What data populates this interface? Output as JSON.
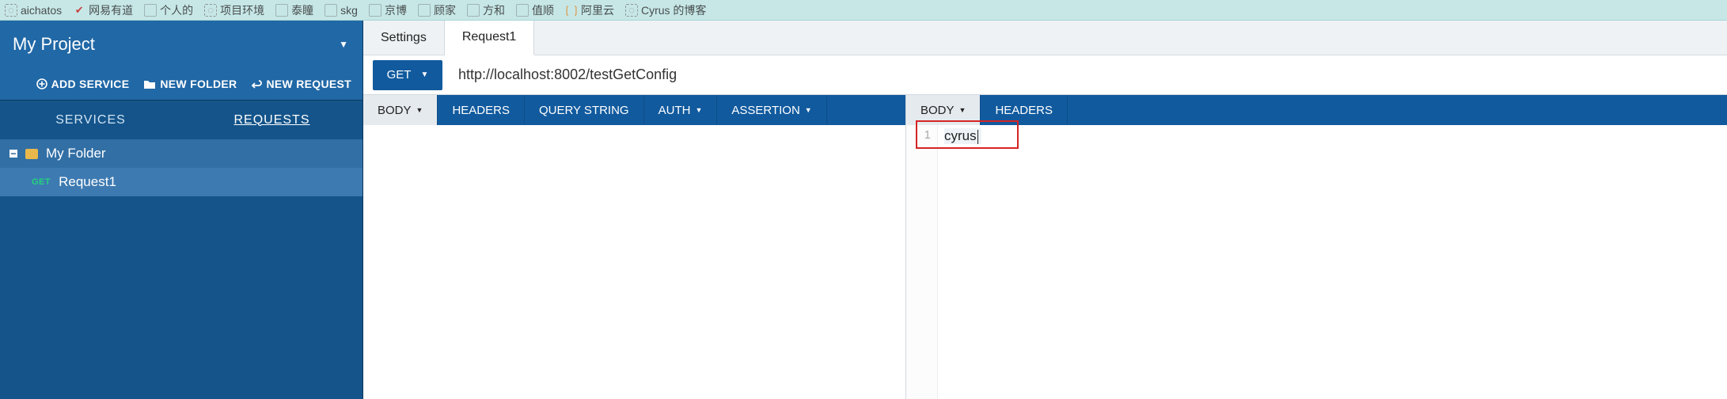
{
  "bookmarks": [
    {
      "label": "aichatos",
      "iconClass": "dotted"
    },
    {
      "label": "网易有道",
      "iconClass": "red"
    },
    {
      "label": "个人的",
      "iconClass": "box"
    },
    {
      "label": "项目环境",
      "iconClass": "dotted"
    },
    {
      "label": "泰瞳",
      "iconClass": "box"
    },
    {
      "label": "skg",
      "iconClass": "box"
    },
    {
      "label": "京博",
      "iconClass": "box"
    },
    {
      "label": "顾家",
      "iconClass": "box"
    },
    {
      "label": "方和",
      "iconClass": "box"
    },
    {
      "label": "值顺",
      "iconClass": "box"
    },
    {
      "label": "阿里云",
      "iconClass": "orange"
    },
    {
      "label": "Cyrus 的博客",
      "iconClass": "dotted"
    }
  ],
  "sidebar": {
    "title": "My Project",
    "actions": {
      "addService": "ADD SERVICE",
      "newFolder": "NEW FOLDER",
      "newRequest": "NEW REQUEST"
    },
    "tabs": {
      "services": "SERVICES",
      "requests": "REQUESTS"
    },
    "activeTab": "REQUESTS",
    "tree": {
      "folderName": "My Folder",
      "item": {
        "method": "GET",
        "name": "Request1"
      }
    }
  },
  "mainTabs": [
    {
      "label": "Settings",
      "active": false
    },
    {
      "label": "Request1",
      "active": true
    }
  ],
  "request": {
    "method": "GET",
    "url": "http://localhost:8002/testGetConfig",
    "leftTabs": [
      {
        "label": "BODY",
        "caret": true,
        "selected": true
      },
      {
        "label": "HEADERS",
        "caret": false,
        "selected": false
      },
      {
        "label": "QUERY STRING",
        "caret": false,
        "selected": false
      },
      {
        "label": "AUTH",
        "caret": true,
        "selected": false
      },
      {
        "label": "ASSERTION",
        "caret": true,
        "selected": false
      }
    ],
    "rightTabs": [
      {
        "label": "BODY",
        "caret": true,
        "selected": true
      },
      {
        "label": "HEADERS",
        "caret": false,
        "selected": false
      }
    ]
  },
  "responseEditor": {
    "lineNumber": "1",
    "content": "cyrus"
  }
}
